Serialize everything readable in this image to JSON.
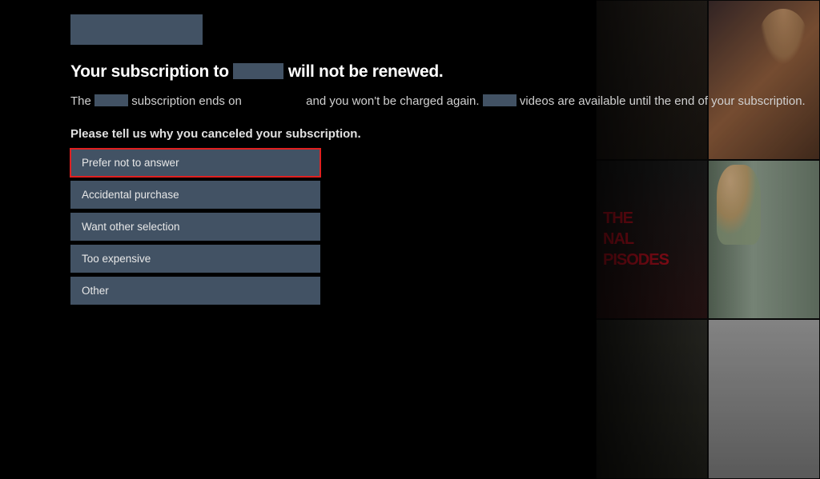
{
  "heading": {
    "prefix": "Your subscription to",
    "suffix": "will not be renewed."
  },
  "subtext": {
    "part1": "The",
    "part2": "subscription ends on",
    "part3": "and you won't be charged again.",
    "part4": "videos are available until the end of your subscription."
  },
  "prompt": "Please tell us why you canceled your subscription.",
  "options": [
    {
      "label": "Prefer not to answer",
      "selected": true
    },
    {
      "label": "Accidental purchase",
      "selected": false
    },
    {
      "label": "Want other selection",
      "selected": false
    },
    {
      "label": "Too expensive",
      "selected": false
    },
    {
      "label": "Other",
      "selected": false
    }
  ],
  "poster_text": {
    "line1": "THE",
    "line2": "NAL",
    "line3": "PISODES"
  }
}
